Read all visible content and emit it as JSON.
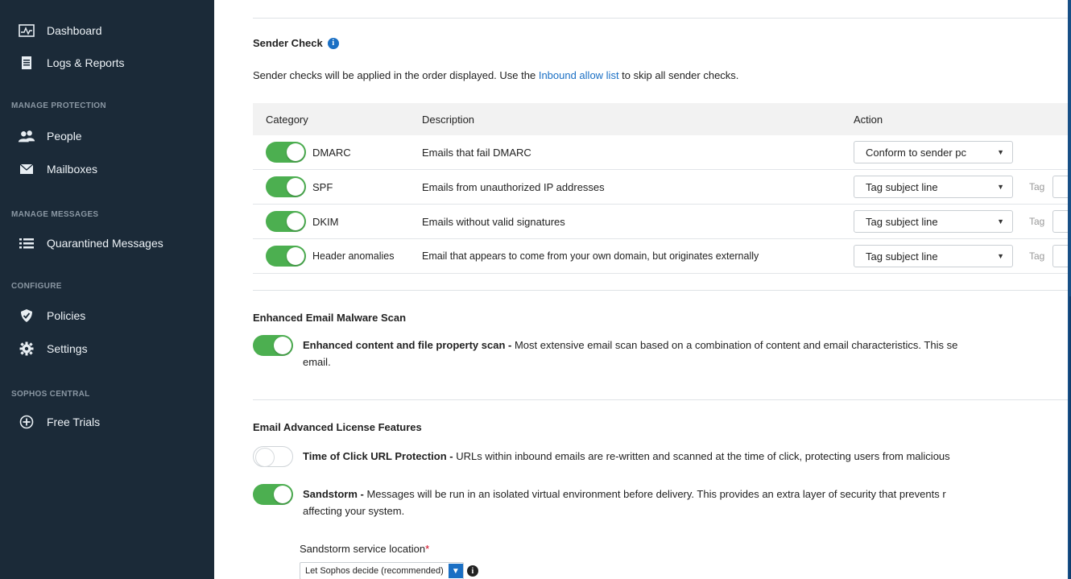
{
  "sidebar": {
    "items": [
      {
        "label": "Dashboard",
        "icon": "dashboard-icon"
      },
      {
        "label": "Logs & Reports",
        "icon": "report-icon"
      }
    ],
    "sections": [
      {
        "header": "MANAGE PROTECTION",
        "items": [
          {
            "label": "People",
            "icon": "people-icon"
          },
          {
            "label": "Mailboxes",
            "icon": "envelope-icon"
          }
        ]
      },
      {
        "header": "MANAGE MESSAGES",
        "items": [
          {
            "label": "Quarantined Messages",
            "icon": "list-icon"
          }
        ]
      },
      {
        "header": "CONFIGURE",
        "items": [
          {
            "label": "Policies",
            "icon": "shield-icon"
          },
          {
            "label": "Settings",
            "icon": "gear-icon"
          }
        ]
      },
      {
        "header": "SOPHOS CENTRAL",
        "items": [
          {
            "label": "Free Trials",
            "icon": "plus-circle-icon"
          }
        ]
      }
    ]
  },
  "sender_check": {
    "title": "Sender Check",
    "desc_pre": "Sender checks will be applied in the order displayed. Use the ",
    "desc_link": "Inbound allow list",
    "desc_post": " to skip all sender checks.",
    "columns": {
      "category": "Category",
      "description": "Description",
      "action": "Action"
    },
    "rows": [
      {
        "category": "DMARC",
        "description": "Emails that fail DMARC",
        "action": "Conform to sender pc",
        "enabled": true,
        "tag": ""
      },
      {
        "category": "SPF",
        "description": "Emails from unauthorized IP addresses",
        "action": "Tag subject line",
        "enabled": true,
        "tag": "Tag"
      },
      {
        "category": "DKIM",
        "description": "Emails without valid signatures",
        "action": "Tag subject line",
        "enabled": true,
        "tag": "Tag"
      },
      {
        "category": "Header anomalies",
        "description": "Email that appears to come from your own domain, but originates externally",
        "action": "Tag subject line",
        "enabled": true,
        "tag": "Tag"
      }
    ]
  },
  "malware_scan": {
    "title": "Enhanced Email Malware Scan",
    "feature_name": "Enhanced content and file property scan -",
    "feature_desc": " Most extensive email scan based on a combination of content and email characteristics. This se",
    "feature_desc2": "email.",
    "enabled": true
  },
  "advanced": {
    "title": "Email Advanced License Features",
    "toc_name": "Time of Click URL Protection -",
    "toc_desc": " URLs within inbound emails are re-written and scanned at the time of click, protecting users from malicious",
    "toc_enabled": false,
    "sandstorm_name": "Sandstorm -",
    "sandstorm_desc": " Messages will be run in an isolated virtual environment before delivery. This provides an extra layer of security that prevents r",
    "sandstorm_desc2": "affecting your system.",
    "sandstorm_enabled": true,
    "location_label": "Sandstorm service location",
    "location_required": "*",
    "location_value": "Let Sophos decide (recommended)"
  },
  "colors": {
    "accent": "#1a6fc4",
    "toggle_on": "#4caf50",
    "sidebar_bg": "#1b2a38"
  }
}
